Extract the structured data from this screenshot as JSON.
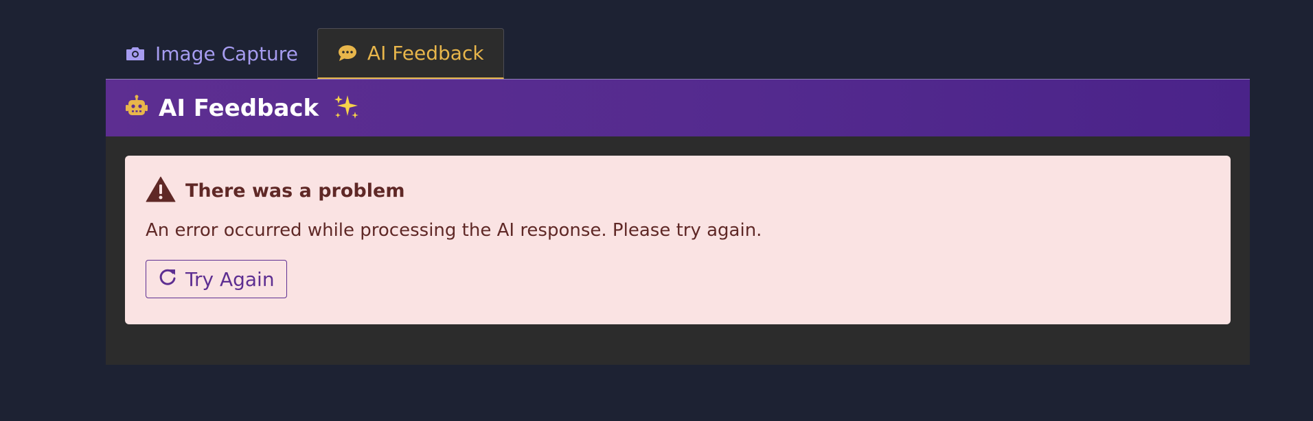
{
  "tabs": [
    {
      "label": "Image Capture",
      "icon": "camera-icon",
      "active": false
    },
    {
      "label": "AI Feedback",
      "icon": "comment-icon",
      "active": true
    }
  ],
  "panel": {
    "title": "AI Feedback",
    "icon": "robot-icon",
    "decoration": "sparkles-icon"
  },
  "alert": {
    "title": "There was a problem",
    "message": "An error occurred while processing the AI response. Please try again.",
    "icon": "warning-icon",
    "retry_label": "Try Again",
    "retry_icon": "redo-icon"
  },
  "colors": {
    "page_bg": "#1d2233",
    "tab_inactive": "#a69cf0",
    "tab_active": "#e8b64b",
    "header_gradient_start": "#5d2e91",
    "header_gradient_end": "#4a2389",
    "alert_bg": "#fae3e3",
    "alert_text": "#5f2826"
  }
}
